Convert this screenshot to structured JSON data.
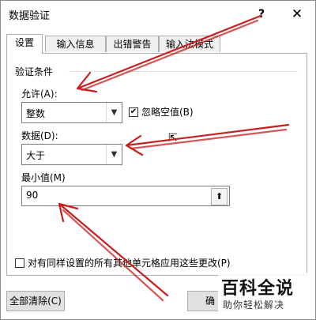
{
  "window": {
    "title": "数据验证",
    "help_glyph": "?",
    "close_glyph": "✕"
  },
  "tabs": [
    {
      "label": "设置",
      "active": true
    },
    {
      "label": "输入信息",
      "active": false
    },
    {
      "label": "出错警告",
      "active": false
    },
    {
      "label": "输入法模式",
      "active": false
    }
  ],
  "settings": {
    "group_label": "验证条件",
    "allow_label": "允许(A):",
    "allow_value": "整数",
    "ignore_blank_label": "忽略空值(B)",
    "ignore_blank_checked": true,
    "data_label": "数据(D):",
    "data_value": "大于",
    "min_label": "最小值(M)",
    "min_value": "90",
    "apply_all_label": "对有同样设置的所有其他单元格应用这些更改(P)",
    "apply_all_checked": false
  },
  "footer": {
    "clear_all_label": "全部清除(C)",
    "ok_label": "确"
  },
  "watermark": {
    "line1": "百科全说",
    "line2": "助你轻松解决"
  },
  "icons": {
    "dropdown": "chevron-down-icon",
    "range_picker": "up-arrow-icon",
    "check": "check-icon"
  },
  "colors": {
    "arrow": "#c81e1e",
    "border": "#adadad",
    "button": "#e1e1e1"
  }
}
